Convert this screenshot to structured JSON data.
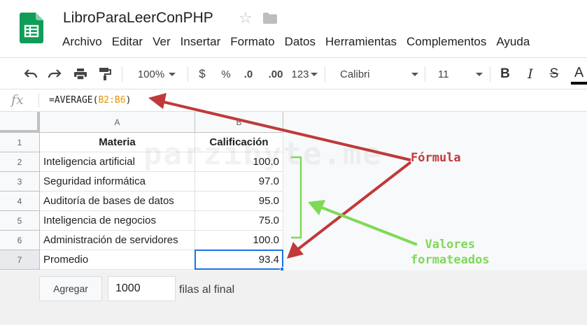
{
  "doc": {
    "title": "LibroParaLeerConPHP"
  },
  "menu": [
    "Archivo",
    "Editar",
    "Ver",
    "Insertar",
    "Formato",
    "Datos",
    "Herramientas",
    "Complementos",
    "Ayuda"
  ],
  "toolbar": {
    "zoom": "100%",
    "currency": "$",
    "percent": "%",
    "dec_decrease": ".0",
    "dec_increase": ".00",
    "more_formats": "123",
    "font": "Calibri",
    "font_size": "11",
    "bold": "B",
    "italic": "I",
    "strike": "S",
    "text_color": "A"
  },
  "formula_bar": {
    "fx": "fx",
    "prefix": "=AVERAGE(",
    "range": "B2:B6",
    "suffix": ")"
  },
  "columns": [
    "A",
    "B"
  ],
  "rows": [
    {
      "num": "1",
      "a": "Materia",
      "b": "Calificación"
    },
    {
      "num": "2",
      "a": "Inteligencia artificial",
      "b": "100.0"
    },
    {
      "num": "3",
      "a": "Seguridad informática",
      "b": "97.0"
    },
    {
      "num": "4",
      "a": "Auditoría de bases de datos",
      "b": "95.0"
    },
    {
      "num": "5",
      "a": "Inteligencia de negocios",
      "b": "75.0"
    },
    {
      "num": "6",
      "a": "Administración de servidores",
      "b": "100.0"
    },
    {
      "num": "7",
      "a": "Promedio",
      "b": "93.4"
    }
  ],
  "add_rows": {
    "button": "Agregar",
    "count": "1000",
    "label": "filas al final"
  },
  "annotations": {
    "formula": "Fórmula",
    "values_line1": "Valores",
    "values_line2": "formateados",
    "watermark": "parzibyte.me"
  },
  "colors": {
    "accent": "#1a73e8",
    "logo": "#0f9d58",
    "red_arrow": "#c0393a",
    "green_arrow": "#7ed957",
    "range_ref": "#e59400"
  }
}
